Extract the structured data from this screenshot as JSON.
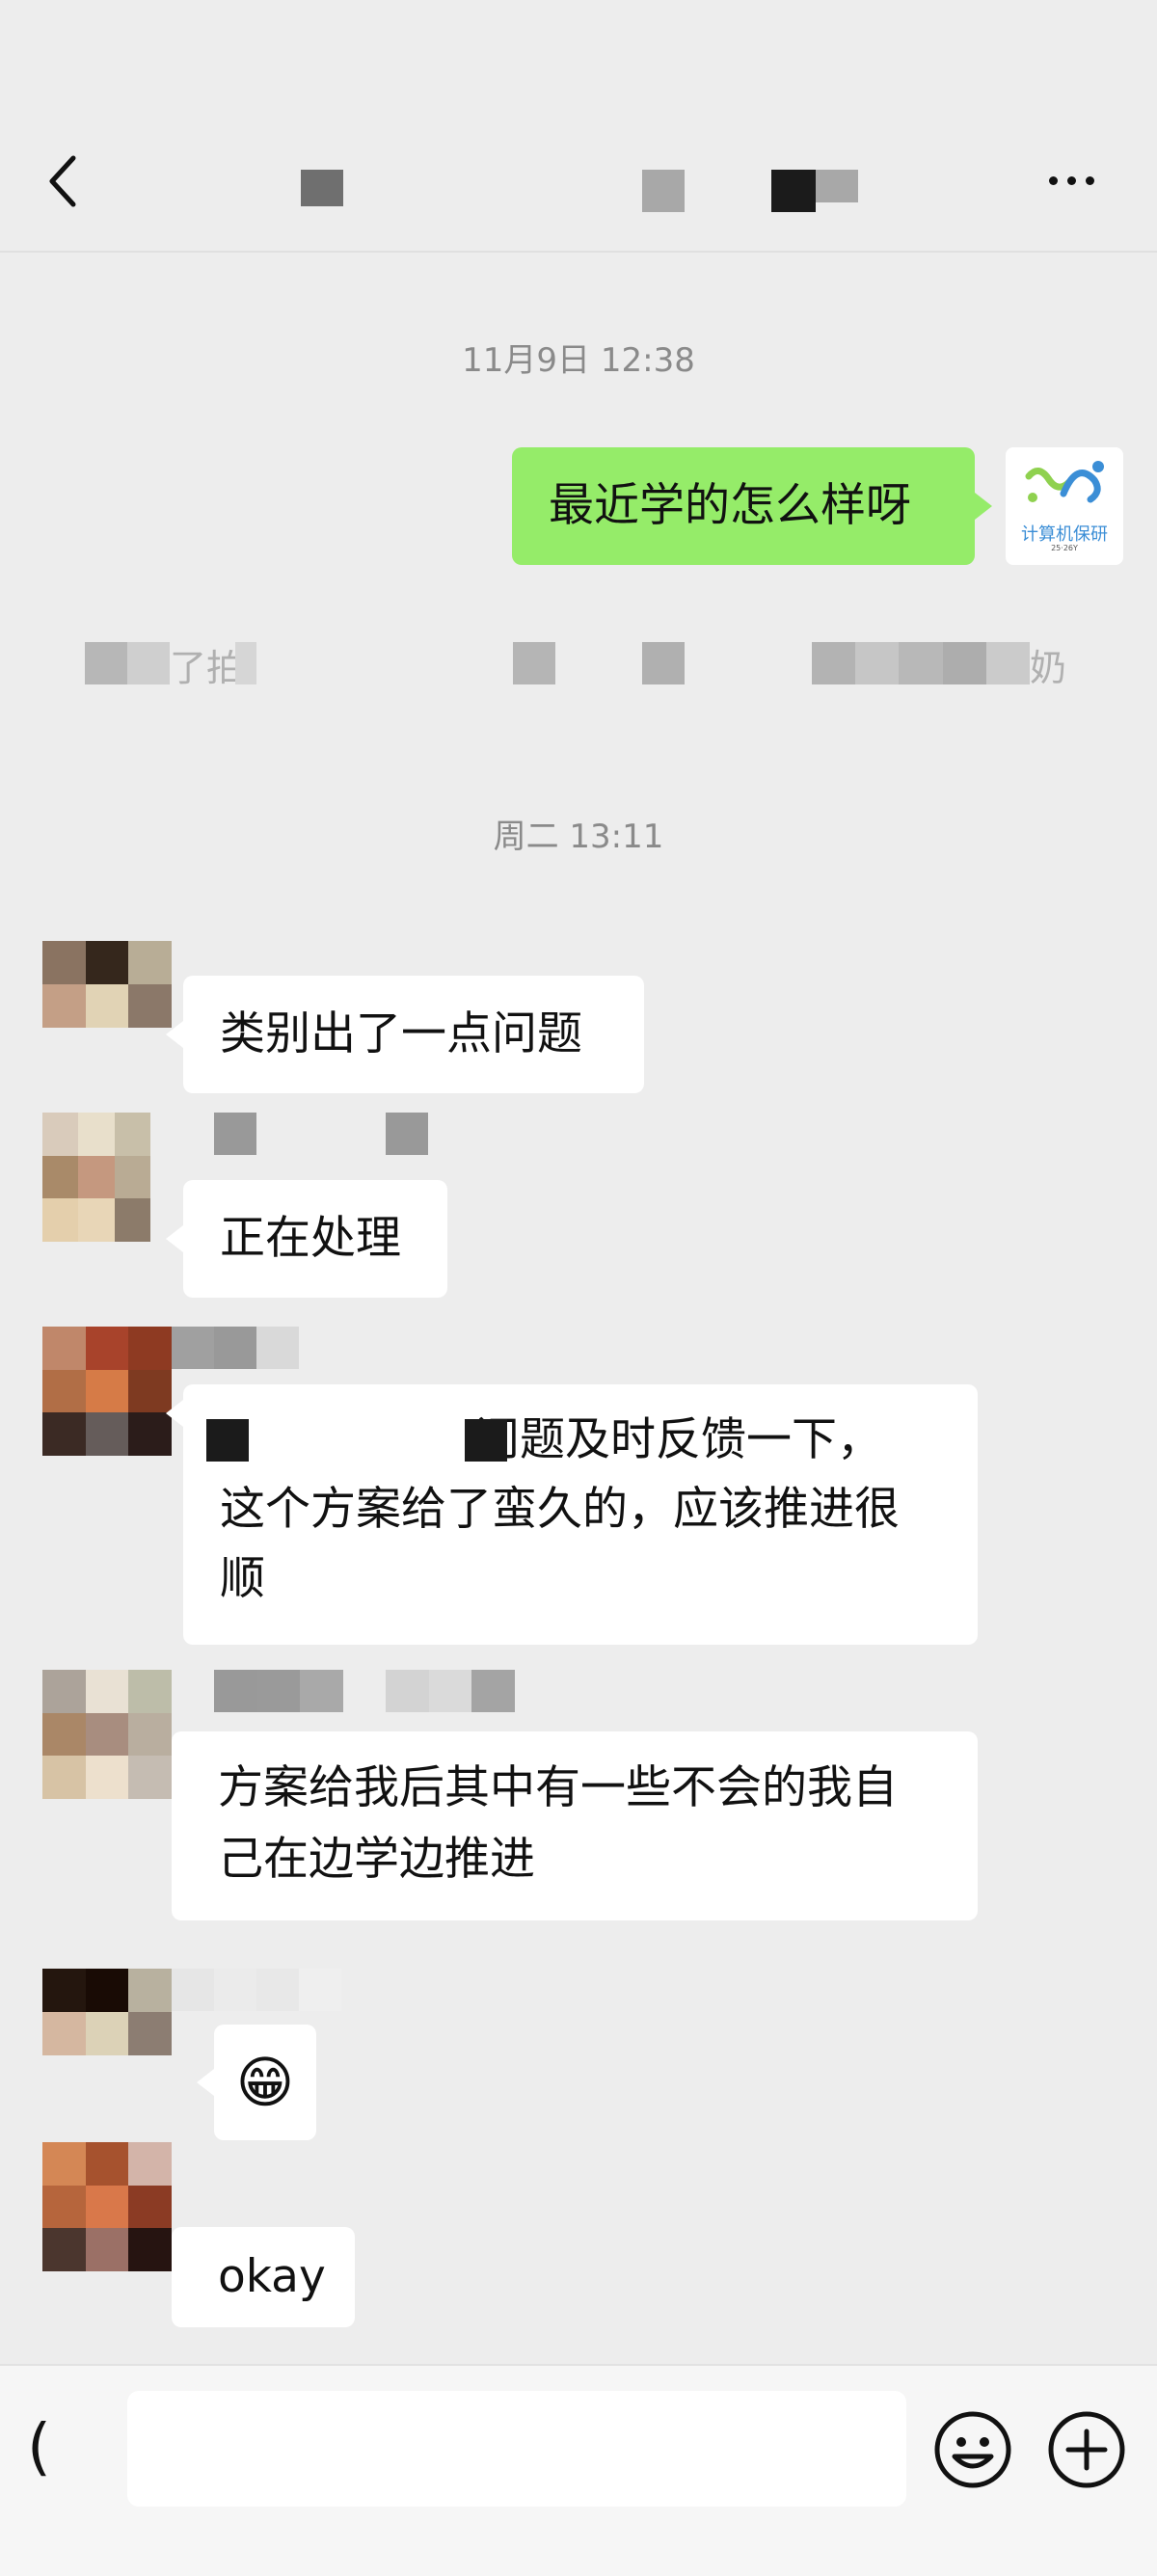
{
  "header": {
    "back_label": "‹",
    "more_label": "more"
  },
  "timestamps": [
    "11月9日 12:38",
    "周二 13:11"
  ],
  "system_notice": {
    "prefix_fragment": "了拍",
    "suffix_fragment": "奶"
  },
  "avatars": {
    "me_caption": "计算机保研",
    "me_subcaption": "25·26Y"
  },
  "messages": [
    {
      "sender": "me",
      "text": "最近学的怎么样呀"
    },
    {
      "sender": "other",
      "text": "类别出了一点问题"
    },
    {
      "sender": "other",
      "text": "正在处理"
    },
    {
      "sender": "other",
      "text_line1": "问题及时反馈一下，",
      "text_line2": "这个方案给了蛮久的，应该推进很",
      "text_line3": "顺"
    },
    {
      "sender": "other",
      "text_line1": "方案给我后其中有一些不会的我自",
      "text_line2": "己在边学边推进"
    },
    {
      "sender": "other",
      "emoji": "😁"
    },
    {
      "sender": "other",
      "text": "okay"
    }
  ],
  "input_bar": {
    "voice_glyph": "(",
    "placeholder": ""
  },
  "icons": {
    "back": "back-chevron-icon",
    "more": "more-dots-icon",
    "emoji": "emoji-face-icon",
    "plus": "plus-circle-icon"
  },
  "colors": {
    "background": "#ededed",
    "my_bubble": "#95ec69",
    "other_bubble": "#ffffff",
    "timestamp": "#8a8a8a"
  }
}
